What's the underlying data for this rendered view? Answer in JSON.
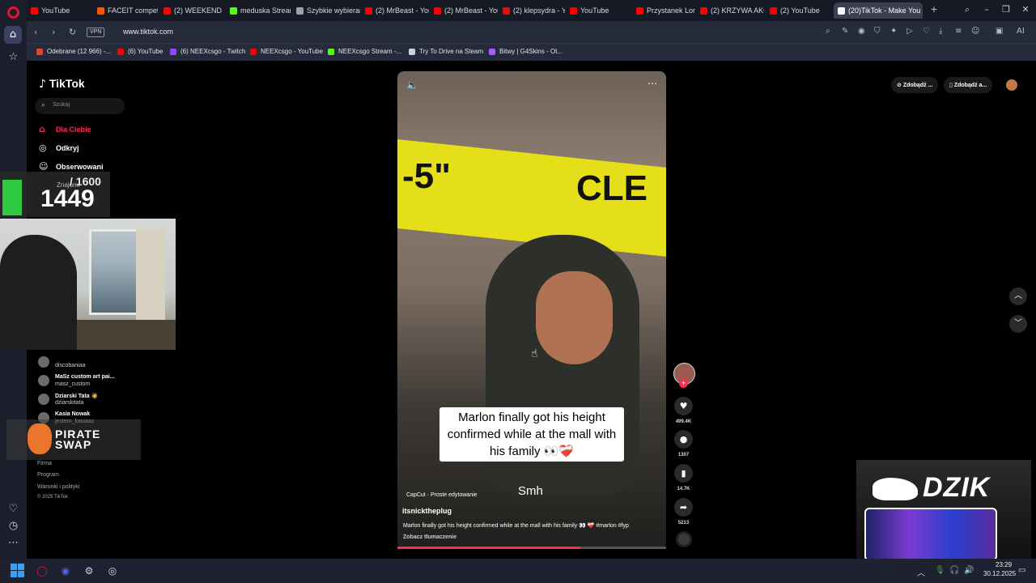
{
  "browser": {
    "tabs": [
      {
        "label": "YouTube",
        "color": "#ff0000"
      },
      {
        "label": "FACEIT competiti",
        "color": "#ff5500"
      },
      {
        "label": "(2) WEEKEND - H",
        "color": "#ff0000"
      },
      {
        "label": "meduska Stream",
        "color": "#53fc18"
      },
      {
        "label": "Szybkie wybieran",
        "color": "#9aa0b0"
      },
      {
        "label": "(2) MrBeast - You",
        "color": "#ff0000"
      },
      {
        "label": "(2) MrBeast - You",
        "color": "#ff0000"
      },
      {
        "label": "(2) klepsydra - Yo",
        "color": "#ff0000"
      },
      {
        "label": "YouTube",
        "color": "#ff0000"
      },
      {
        "label": "Przystanek Lomb",
        "color": "#ff0000"
      },
      {
        "label": "(2) KRZYWA AKC",
        "color": "#ff0000"
      },
      {
        "label": "(2) YouTube",
        "color": "#ff0000"
      },
      {
        "label": "(20)TikTok - Make You",
        "color": "#ffffff"
      }
    ],
    "url": "www.tiktok.com",
    "vpn_label": "VPN",
    "bookmarks": [
      {
        "label": "Odebrane (12 966) -...",
        "color": "#ea4335"
      },
      {
        "label": "(6) YouTube",
        "color": "#ff0000"
      },
      {
        "label": "(6) NEEXcsgo - Twitch",
        "color": "#9146ff"
      },
      {
        "label": "NEEXcsgo - YouTube",
        "color": "#ff0000"
      },
      {
        "label": "NEEXcsgo Stream -...",
        "color": "#53fc18"
      },
      {
        "label": "Try To Drive na Steam",
        "color": "#c7d5e0"
      },
      {
        "label": "Bitwy | G4Skins - Ot...",
        "color": "#a45cff"
      }
    ]
  },
  "tiktok": {
    "logo": "TikTok",
    "search_placeholder": "Szukaj",
    "nav": [
      {
        "label": "Dla Ciebie",
        "icon": "home-icon",
        "active": true
      },
      {
        "label": "Odkryj",
        "icon": "compass-icon"
      },
      {
        "label": "Obserwowani",
        "icon": "users-icon"
      },
      {
        "label": "Znajomi",
        "icon": "friends-icon"
      }
    ],
    "following": [
      {
        "name": "",
        "user": "discobaniaa"
      },
      {
        "name": "MaSz custom art pai...",
        "user": "masz_custom"
      },
      {
        "name": "Dziarski Tata 🧔",
        "user": "dziarskitata"
      },
      {
        "name": "Kasia Nowak",
        "user": "jestem_kasiaaz"
      }
    ],
    "footer": [
      "Firma",
      "Program",
      "Warunki i polityki",
      "© 2025 TikTok"
    ],
    "top_right": {
      "coins_label": "Zdobądź ...",
      "app_label": "Zdobądź a..."
    },
    "video": {
      "tape_text_left": "-5\"",
      "tape_text_right": "CLE",
      "caption": "Marlon finally got his height confirmed while at the mall with his family 👀❤️‍🩹",
      "subtitle": "Smh",
      "capcut": "CapCut · Proste edytowanie",
      "author": "itsnicktheplug",
      "description": "Marlon finally got his height confirmed while at the mall with his family 👀 ❤️‍🩹 #marlon #fyp",
      "translate": "Zobacz tłumaczenie",
      "progress": 0.68
    },
    "actions": {
      "likes": "499.4K",
      "comments": "1307",
      "saves": "14.7K",
      "shares": "5213"
    }
  },
  "overlay": {
    "counter_goal": "/ 1600",
    "counter_value": "1449",
    "sponsor1_line1": "PIRATE",
    "sponsor1_line2": "SWAP",
    "sponsor2": "DZIK"
  },
  "taskbar": {
    "time": "23:29",
    "date": "30.12.2025"
  }
}
